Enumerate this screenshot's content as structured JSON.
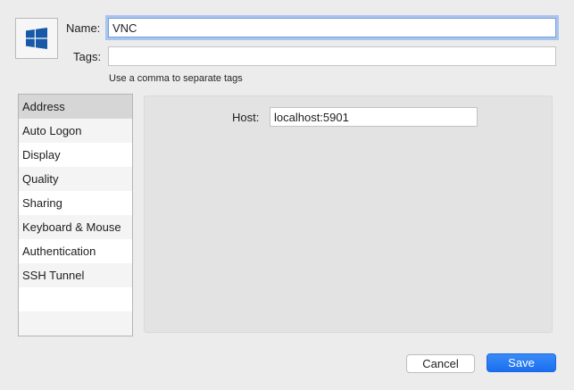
{
  "icon": {
    "name": "windows-logo-icon",
    "color": "#1659a8"
  },
  "name_field": {
    "label": "Name:",
    "value": "VNC"
  },
  "tags_field": {
    "label": "Tags:",
    "value": "",
    "hint": "Use a comma to separate tags"
  },
  "sidebar": {
    "items": [
      {
        "label": "Address"
      },
      {
        "label": "Auto Logon"
      },
      {
        "label": "Display"
      },
      {
        "label": "Quality"
      },
      {
        "label": "Sharing"
      },
      {
        "label": "Keyboard & Mouse"
      },
      {
        "label": "Authentication"
      },
      {
        "label": "SSH Tunnel"
      }
    ],
    "selected": "Address"
  },
  "address_panel": {
    "host_label": "Host:",
    "host_value": "localhost:5901"
  },
  "buttons": {
    "cancel_label": "Cancel",
    "save_label": "Save"
  },
  "colors": {
    "accent": "#1a6ff0",
    "focus_ring": "#a9c4ee",
    "background": "#ececec"
  }
}
